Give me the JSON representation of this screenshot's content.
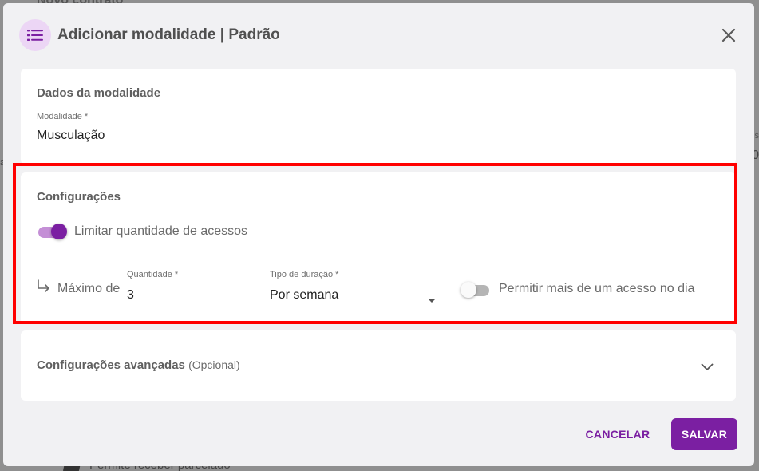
{
  "background": {
    "page_title": "Novo contrato",
    "footer_text": "Permite receber parcelado",
    "right_peek_1": "es",
    "right_peek_2": "0",
    "left_peek": "a"
  },
  "dialog": {
    "title": "Adicionar modalidade | Padrão",
    "icon": "list-icon",
    "close_icon": "close-icon"
  },
  "dados": {
    "section_title": "Dados da modalidade",
    "modalidade_label": "Modalidade *",
    "modalidade_value": "Musculação"
  },
  "configuracoes": {
    "section_title": "Configurações",
    "limitar_label": "Limitar quantidade de acessos",
    "limitar_on": true,
    "maximo_label": "Máximo de",
    "arrow_icon": "subdirectory-arrow-right-icon",
    "quantidade_label": "Quantidade *",
    "quantidade_value": "3",
    "tipo_label": "Tipo de duração *",
    "tipo_value": "Por semana",
    "dropdown_icon": "caret-down-icon",
    "permitir_label": "Permitir mais de um acesso no dia",
    "permitir_on": false
  },
  "avancadas": {
    "section_title": "Configurações avançadas",
    "optional": "(Opcional)",
    "chevron_icon": "chevron-down-icon"
  },
  "actions": {
    "cancel": "CANCELAR",
    "save": "SALVAR"
  },
  "colors": {
    "accent": "#7b1fa2",
    "accent_light": "#c48fd6",
    "highlight_frame": "#ff0000"
  }
}
